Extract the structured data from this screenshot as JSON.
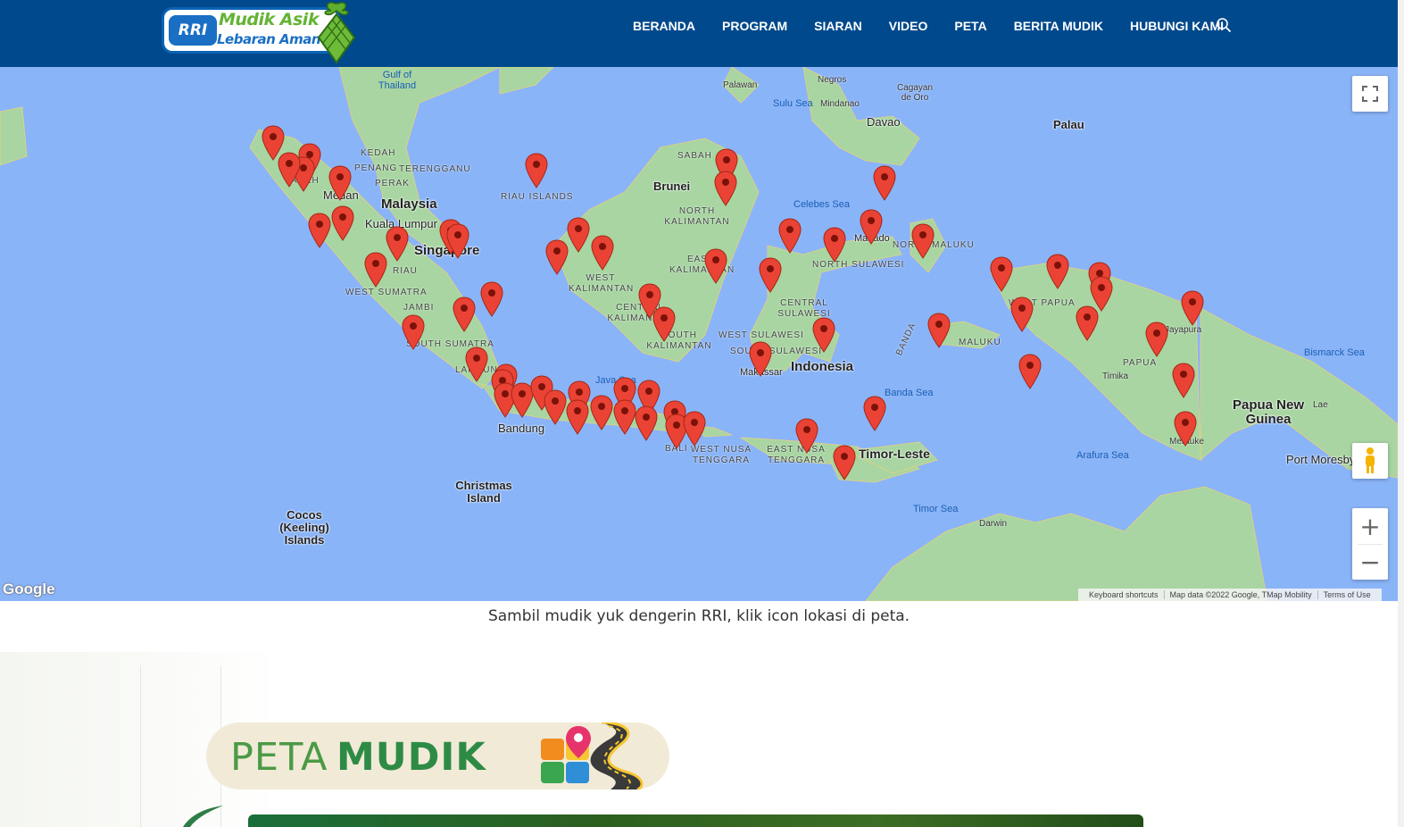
{
  "header": {
    "logo": {
      "badge_text": "RRI",
      "line1": "Mudik Asik",
      "line2": "Lebaran Aman"
    },
    "nav": [
      {
        "label": "BERANDA"
      },
      {
        "label": "PROGRAM"
      },
      {
        "label": "SIARAN"
      },
      {
        "label": "VIDEO"
      },
      {
        "label": "PETA"
      },
      {
        "label": "BERITA MUDIK"
      },
      {
        "label": "HUBUNGI KAMI"
      }
    ],
    "search_icon": "search-icon",
    "background_color": "#00498c"
  },
  "map": {
    "labels": {
      "countries": [
        "Malaysia",
        "Singapore",
        "Brunei",
        "Indonesia",
        "Timor-Leste",
        "Papua New Guinea",
        "Palau"
      ],
      "cities": [
        "Medan",
        "Kuala Lumpur",
        "Bandung",
        "Makassar",
        "Manado",
        "Davao",
        "Port Moresby",
        "Darwin",
        "Timika",
        "Merauke",
        "Jayapura",
        "Lae",
        "Mindanao",
        "Negros",
        "Palawan",
        "Cagayan de Oro"
      ],
      "regions": [
        "ACEH",
        "KEDAH",
        "PENANG",
        "TERENGGANU",
        "PERAK",
        "RIAU",
        "WEST SUMATRA",
        "JAMBI",
        "SOUTH SUMATRA",
        "LAMPUNG",
        "RIAU ISLANDS",
        "SABAH",
        "NORTH KALIMANTAN",
        "EAST KALIMANTAN",
        "WEST KALIMANTAN",
        "CENTRAL KALIMANTAN",
        "SOUTH KALIMANTAN",
        "NORTH SULAWESI",
        "NORTH MALUKU",
        "CENTRAL SULAWESI",
        "WEST SULAWESI",
        "SOUTH SULAWESI",
        "MALUKU",
        "WEST PAPUA",
        "PAPUA",
        "BALI",
        "WEST NUSA TENGGARA",
        "EAST NUSA TENGGARA",
        "BANDA"
      ],
      "seas": [
        "Gulf of Thailand",
        "Sulu Sea",
        "Celebes Sea",
        "Java Sea",
        "Banda Sea",
        "Arafura Sea",
        "Timor Sea",
        "Bismarck Sea"
      ],
      "islands": [
        "Christmas Island",
        "Cocos (Keeling) Islands"
      ]
    },
    "marker_count": 68,
    "marker_color": "#ea4335",
    "controls": {
      "fullscreen_icon": "fullscreen-icon",
      "pegman_icon": "pegman-icon",
      "zoom_in": "+",
      "zoom_out": "−"
    },
    "google_logo": "Google",
    "attribution": {
      "shortcuts": "Keyboard shortcuts",
      "data": "Map data ©2022 Google, TMap Mobility",
      "terms": "Terms of Use"
    },
    "water_color": "#8ab4f8",
    "land_color": "#9fd29c"
  },
  "caption": "Sambil mudik yuk dengerin RRI, klik icon lokasi di peta.",
  "banner": {
    "word1": "PETA",
    "word2": "MUDIK",
    "icon": "map-road-icon"
  }
}
